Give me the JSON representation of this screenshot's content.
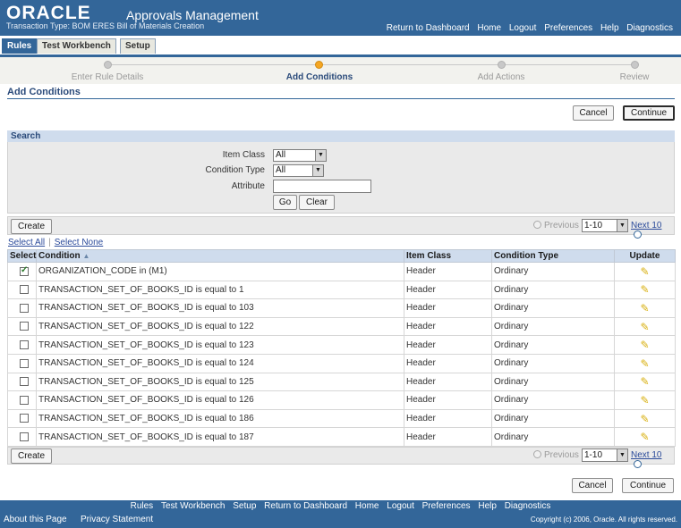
{
  "header": {
    "logo": "ORACLE",
    "app_title": "Approvals Management",
    "transaction_type": "Transaction Type: BOM ERES Bill of Materials Creation",
    "global_links": [
      "Return to Dashboard",
      "Home",
      "Logout",
      "Preferences",
      "Help",
      "Diagnostics"
    ]
  },
  "tabs": [
    {
      "label": "Rules",
      "active": true
    },
    {
      "label": "Test Workbench",
      "active": false
    },
    {
      "label": "Setup",
      "active": false
    }
  ],
  "train": {
    "steps": [
      "Enter Rule Details",
      "Add Conditions",
      "Add Actions",
      "Review"
    ],
    "current_index": 1
  },
  "page": {
    "title": "Add Conditions",
    "cancel_label": "Cancel",
    "continue_label": "Continue"
  },
  "search": {
    "header": "Search",
    "item_class_label": "Item Class",
    "item_class_value": "All",
    "condition_type_label": "Condition Type",
    "condition_type_value": "All",
    "attribute_label": "Attribute",
    "attribute_value": "",
    "go_label": "Go",
    "clear_label": "Clear"
  },
  "results": {
    "create_label": "Create",
    "previous_label": "Previous",
    "range_value": "1-10",
    "next_label": "Next 10",
    "select_all_label": "Select All",
    "select_none_label": "Select None",
    "columns": [
      "Select",
      "Condition",
      "Item Class",
      "Condition Type",
      "Update"
    ],
    "rows": [
      {
        "checked": true,
        "condition": "ORGANIZATION_CODE in (M1)",
        "item_class": "Header",
        "condition_type": "Ordinary"
      },
      {
        "checked": false,
        "condition": "TRANSACTION_SET_OF_BOOKS_ID is equal to 1",
        "item_class": "Header",
        "condition_type": "Ordinary"
      },
      {
        "checked": false,
        "condition": "TRANSACTION_SET_OF_BOOKS_ID is equal to 103",
        "item_class": "Header",
        "condition_type": "Ordinary"
      },
      {
        "checked": false,
        "condition": "TRANSACTION_SET_OF_BOOKS_ID is equal to 122",
        "item_class": "Header",
        "condition_type": "Ordinary"
      },
      {
        "checked": false,
        "condition": "TRANSACTION_SET_OF_BOOKS_ID is equal to 123",
        "item_class": "Header",
        "condition_type": "Ordinary"
      },
      {
        "checked": false,
        "condition": "TRANSACTION_SET_OF_BOOKS_ID is equal to 124",
        "item_class": "Header",
        "condition_type": "Ordinary"
      },
      {
        "checked": false,
        "condition": "TRANSACTION_SET_OF_BOOKS_ID is equal to 125",
        "item_class": "Header",
        "condition_type": "Ordinary"
      },
      {
        "checked": false,
        "condition": "TRANSACTION_SET_OF_BOOKS_ID is equal to 126",
        "item_class": "Header",
        "condition_type": "Ordinary"
      },
      {
        "checked": false,
        "condition": "TRANSACTION_SET_OF_BOOKS_ID is equal to 186",
        "item_class": "Header",
        "condition_type": "Ordinary"
      },
      {
        "checked": false,
        "condition": "TRANSACTION_SET_OF_BOOKS_ID is equal to 187",
        "item_class": "Header",
        "condition_type": "Ordinary"
      }
    ]
  },
  "footer": {
    "links": [
      "Rules",
      "Test Workbench",
      "Setup",
      "Return to Dashboard",
      "Home",
      "Logout",
      "Preferences",
      "Help",
      "Diagnostics"
    ],
    "about": "About this Page",
    "privacy": "Privacy Statement",
    "copyright": "Copyright (c) 2006, Oracle. All rights reserved."
  },
  "colors": {
    "brand_blue": "#336699",
    "header_light": "#cfdced",
    "train_current": "#f5a623"
  }
}
